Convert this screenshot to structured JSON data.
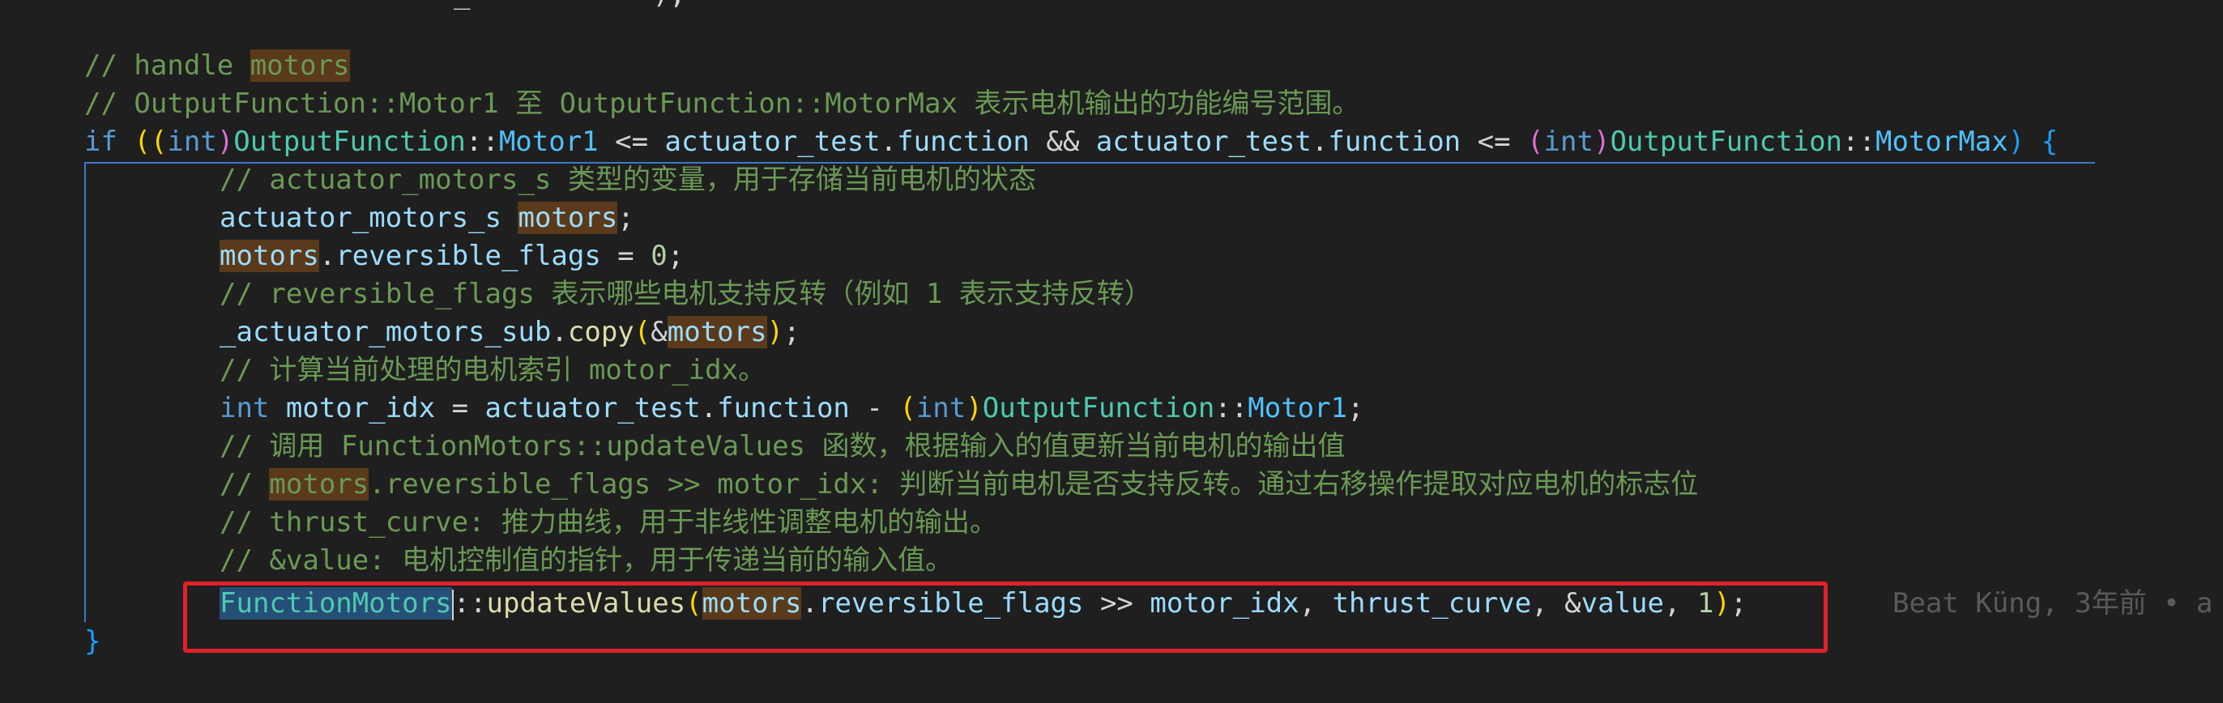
{
  "editor": {
    "top_fragment": "_           );",
    "lines": {
      "c1": "// handle ",
      "c1_word": "motors",
      "c2": "// OutputFunction::Motor1 至 OutputFunction::MotorMax 表示电机输出的功能编号范围。",
      "if_kw": "if",
      "if_p1": "((",
      "if_int1": "int",
      "if_p2": ")",
      "if_cls1": "OutputFunction",
      "if_sep1": "::",
      "if_m1": "Motor1",
      "if_op1": " <= ",
      "if_v1": "actuator_test",
      "if_dot1": ".",
      "if_f1": "function",
      "if_and": " && ",
      "if_v2": "actuator_test",
      "if_dot2": ".",
      "if_f2": "function",
      "if_op2": " <= ",
      "if_p3": "(",
      "if_int2": "int",
      "if_p4": ")",
      "if_cls2": "OutputFunction",
      "if_sep2": "::",
      "if_m2": "MotorMax",
      "if_p5": ")",
      "if_brace": " {",
      "c3": "// actuator_motors_s 类型的变量，用于存储当前电机的状态",
      "d_type": "actuator_motors_s ",
      "d_var": "motors",
      "d_end": ";",
      "a_var": "motors",
      "a_dot": ".",
      "a_field": "reversible_flags",
      "a_eq": " = ",
      "a_num": "0",
      "a_end": ";",
      "c4": "// reversible_flags 表示哪些电机支持反转（例如 1 表示支持反转）",
      "s_obj": "_actuator_motors_sub",
      "s_dot": ".",
      "s_fn": "copy",
      "s_p1": "(",
      "s_amp": "&",
      "s_var": "motors",
      "s_p2": ")",
      "s_end": ";",
      "c5": "// 计算当前处理的电机索引 motor_idx。",
      "i_kw": "int",
      "i_var": " motor_idx",
      "i_eq": " = ",
      "i_obj": "actuator_test",
      "i_dot": ".",
      "i_f": "function",
      "i_minus": " - ",
      "i_p1": "(",
      "i_int": "int",
      "i_p2": ")",
      "i_cls": "OutputFunction",
      "i_sep": "::",
      "i_m": "Motor1",
      "i_end": ";",
      "c6": "// 调用 FunctionMotors::updateValues 函数，根据输入的值更新当前电机的输出值",
      "c7_pre": "// ",
      "c7_word": "motors",
      "c7_post": ".reversible_flags >> motor_idx: 判断当前电机是否支持反转。通过右移操作提取对应电机的标志位",
      "c8": "// thrust_curve: 推力曲线，用于非线性调整电机的输出。",
      "c9": "// &value: 电机控制值的指针，用于传递当前的输入值。",
      "f_cls": "FunctionMotors",
      "f_sep": "::",
      "f_fn": "updateValues",
      "f_p1": "(",
      "f_var": "motors",
      "f_dot": ".",
      "f_field": "reversible_flags",
      "f_shift": " >> ",
      "f_idx": "motor_idx",
      "f_c1": ", ",
      "f_tc": "thrust_curve",
      "f_c2": ", ",
      "f_amp": "&",
      "f_val": "value",
      "f_c3": ", ",
      "f_num": "1",
      "f_p2": ")",
      "f_end": ";",
      "close": "}"
    },
    "blame": "Beat Küng, 3年前 • a"
  },
  "colors": {
    "background": "#1f1f1f",
    "comment": "#6a9955",
    "keyword": "#569cd6",
    "type": "#4ec9b0",
    "variable": "#9cdcfe",
    "function": "#dcdcaa",
    "number": "#b5cea8",
    "highlight_box": "#e0212b"
  }
}
